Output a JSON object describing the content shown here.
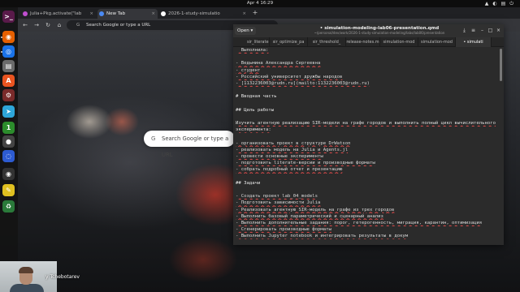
{
  "topbar": {
    "clock": "Apr 4  16:29",
    "tray": [
      "▲",
      "◐",
      "▤",
      "⏻"
    ]
  },
  "dock": {
    "icons": [
      {
        "name": "terminal-icon",
        "color": "#5a1a4a",
        "glyph": ">_"
      },
      {
        "name": "firefox-icon",
        "color": "#e66000",
        "glyph": "◉"
      },
      {
        "name": "chrome-icon",
        "color": "#1a73e8",
        "glyph": "◎"
      },
      {
        "name": "files-icon",
        "color": "#6b6b6b",
        "glyph": "▤"
      },
      {
        "name": "app-center-icon",
        "color": "#e95420",
        "glyph": "A"
      },
      {
        "name": "settings-icon",
        "color": "#7a2a2a",
        "glyph": "⚙"
      },
      {
        "name": "telegram-icon",
        "color": "#2ea6d9",
        "glyph": "➤"
      },
      {
        "name": "counter-app-icon",
        "color": "#2c8c2c",
        "glyph": "1"
      },
      {
        "name": "obs-icon",
        "color": "#444444",
        "glyph": "●"
      },
      {
        "name": "zoom-icon",
        "color": "#2d5bd1",
        "glyph": "◌"
      },
      {
        "name": "recorder-icon",
        "color": "#333333",
        "glyph": "◉"
      },
      {
        "name": "notes-icon",
        "color": "#e0c020",
        "glyph": "✎"
      },
      {
        "name": "trash-icon",
        "color": "#2a7a3a",
        "glyph": "♻"
      }
    ]
  },
  "browser": {
    "tabs": [
      {
        "label": "Julia+Pkg.activate(\"lab",
        "favicon_color": "#c04fd0"
      },
      {
        "label": "New Tab",
        "favicon_color": "#4a8af4"
      },
      {
        "label": "2026-1-study-simulatio",
        "favicon_color": "#ffffff"
      }
    ],
    "new_tab_glyph": "+",
    "omnibox_placeholder": "Search Google or type a URL",
    "ntp_search_placeholder": "Search Google or type a URL"
  },
  "editor": {
    "open_label": "Open ▾",
    "title": "• simulation-modeling-lab06-presentation.qmd",
    "path": "~/personal/dev/work/2026-1-study-simulation-modeling/labs/lab06/presentation",
    "tabs": [
      {
        "label": "sir_literate.jl",
        "active": false
      },
      {
        "label": "sir_optimize_pa",
        "active": false
      },
      {
        "label": "sir_threshold_",
        "active": false
      },
      {
        "label": "release-notes.m",
        "active": false
      },
      {
        "label": "simulation-mod",
        "active": false
      },
      {
        "label": "simulation-mod",
        "active": false
      },
      {
        "label": "• simulati",
        "active": true
      }
    ],
    "lines": [
      {
        "text": "  Выполнила:",
        "kind": "list"
      },
      {
        "text": "",
        "kind": "blank"
      },
      {
        "text": "- Ведьмина Александра Сергеевна",
        "kind": "list"
      },
      {
        "text": "- студент",
        "kind": "list"
      },
      {
        "text": "- Российский университет дружбы народов",
        "kind": "list"
      },
      {
        "text": "- [1132236003@rudn.ru](mailto:1132236003@rudn.ru)",
        "kind": "list"
      },
      {
        "text": "",
        "kind": "blank"
      },
      {
        "text": "# Вводная часть",
        "kind": "head"
      },
      {
        "text": "",
        "kind": "blank"
      },
      {
        "text": "## Цель работы",
        "kind": "head"
      },
      {
        "text": "",
        "kind": "blank"
      },
      {
        "text": "Изучить агентную реализацию SIR-модели на графе городов и выполнить полный цикл вычислительного",
        "kind": "text"
      },
      {
        "text": "эксперимента:",
        "kind": "text"
      },
      {
        "text": "",
        "kind": "blank"
      },
      {
        "text": "- организовать проект в структуре DrWatson",
        "kind": "list"
      },
      {
        "text": "- реализовать модель на Julia и Agents.jl",
        "kind": "list"
      },
      {
        "text": "- провести основные эксперименты",
        "kind": "list"
      },
      {
        "text": "- подготовить literate-версии и производные форматы",
        "kind": "list"
      },
      {
        "text": "- собрать подробный отчет и презентацию",
        "kind": "list"
      },
      {
        "text": "",
        "kind": "blank"
      },
      {
        "text": "## Задачи",
        "kind": "head"
      },
      {
        "text": "",
        "kind": "blank"
      },
      {
        "text": "- Создать проект lab_04_models",
        "kind": "list"
      },
      {
        "text": "- Подготовить зависимости Julia",
        "kind": "list"
      },
      {
        "text": "- Реализовать агентную SIR-модель на графе из трех городов",
        "kind": "list"
      },
      {
        "text": "- Выполнить базовый параметрический и сценарный анализ",
        "kind": "list"
      },
      {
        "text": "- Выполнить дополнительные задания: порог, гетерогенность, миграция, карантин, оптимизация",
        "kind": "list"
      },
      {
        "text": "- Сгенерировать производные форматы",
        "kind": "list"
      },
      {
        "text": "- Выполнить Jupyter notebook и интегрировать результаты в докум",
        "kind": "list"
      }
    ]
  },
  "webcam": {
    "name": "y Tchebotarev"
  }
}
